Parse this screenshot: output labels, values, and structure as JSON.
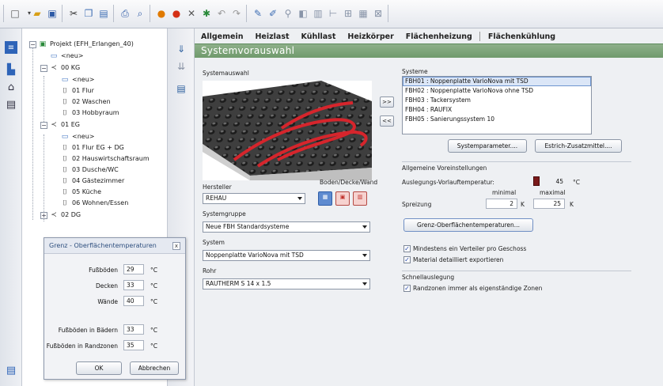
{
  "toolbar": {
    "icons": [
      "new-file-icon",
      "open-folder-icon",
      "save-icon",
      "cut-icon",
      "copy-icon",
      "paste-icon",
      "print-icon",
      "print-preview-icon",
      "info-icon",
      "warning-icon",
      "tools-icon",
      "settings-icon",
      "undo-icon",
      "redo-icon",
      "pencil-icon",
      "draw-icon",
      "plumbing-icon",
      "layer-icon",
      "radiator-icon",
      "pipe-icon",
      "grid-icon",
      "floor-icon",
      "delete-icon"
    ]
  },
  "tree": {
    "items": [
      {
        "label": "Projekt (EFH_Erlangen_40)",
        "level": 0
      },
      {
        "label": "<neu>",
        "level": 1
      },
      {
        "label": "00 KG",
        "level": 1
      },
      {
        "label": "<neu>",
        "level": 2
      },
      {
        "label": "01 Flur",
        "level": 2
      },
      {
        "label": "02 Waschen",
        "level": 2
      },
      {
        "label": "03 Hobbyraum",
        "level": 2
      },
      {
        "label": "01 EG",
        "level": 1
      },
      {
        "label": "<neu>",
        "level": 2
      },
      {
        "label": "01 Flur EG + DG",
        "level": 2
      },
      {
        "label": "02 Hauswirtschaftsraum",
        "level": 2
      },
      {
        "label": "03 Dusche/WC",
        "level": 2
      },
      {
        "label": "04 Gästezimmer",
        "level": 2
      },
      {
        "label": "05 Küche",
        "level": 2
      },
      {
        "label": "06 Wohnen/Essen",
        "level": 2
      },
      {
        "label": "02 DG",
        "level": 1
      }
    ]
  },
  "tabs": [
    "Allgemein",
    "Heizlast",
    "Kühllast",
    "Heizkörper",
    "Flächenheizung",
    "Flächenkühlung"
  ],
  "active_tab": "Flächenheizung",
  "section_title": "Systemvorauswahl",
  "systemauswahl": {
    "label": "Systemauswahl",
    "hersteller_label": "Hersteller",
    "hersteller_value": "REHAU",
    "boden_label": "Boden/Decke/Wand",
    "systemgruppe_label": "Systemgruppe",
    "systemgruppe_value": "Neue FBH Standardsysteme",
    "system_label": "System",
    "system_value": "Noppenplatte VarioNova mit TSD",
    "rohr_label": "Rohr",
    "rohr_value": "RAUTHERM S 14 x 1.5"
  },
  "transfer": {
    "add": ">>",
    "remove": "<<"
  },
  "systeme": {
    "label": "Systeme",
    "items": [
      "FBH01 : Noppenplatte VarioNova mit TSD",
      "FBH02 : Noppenplatte VarioNova ohne TSD",
      "FBH03 : Tackersystem",
      "FBH04 : RAUFIX",
      "FBH05 : Sanierungssystem 10"
    ],
    "selected_index": 0,
    "systemparameter_btn": "Systemparameter....",
    "estrich_btn": "Estrich-Zusatzmittel...."
  },
  "voreinstellungen": {
    "label": "Allgemeine Voreinstellungen",
    "vorlauf_label": "Auslegungs-Vorlauftemperatur:",
    "vorlauf_value": "45",
    "vorlauf_unit": "°C",
    "minimal_label": "minimal",
    "maximal_label": "maximal",
    "spreizung_label": "Spreizung",
    "spreizung_min": "2",
    "spreizung_max": "25",
    "unit_k": "K",
    "grenz_btn": "Grenz-Oberflächentemperaturen...",
    "chk1_label": "Mindestens ein Verteiler pro Geschoss",
    "chk1_checked": true,
    "chk2_label": "Material detailliert exportieren",
    "chk2_checked": true
  },
  "schnell": {
    "label": "Schnellauslegung",
    "chk_label": "Randzonen immer als eigenständige Zonen",
    "chk_checked": true
  },
  "dialog": {
    "title": "Grenz - Oberflächentemperaturen",
    "close": "x",
    "rows": [
      {
        "label": "Fußböden",
        "value": "29",
        "unit": "°C"
      },
      {
        "label": "Decken",
        "value": "33",
        "unit": "°C"
      },
      {
        "label": "Wände",
        "value": "40",
        "unit": "°C"
      },
      {
        "label": "Fußböden in Bädern",
        "value": "33",
        "unit": "°C"
      },
      {
        "label": "Fußböden in Randzonen",
        "value": "35",
        "unit": "°C"
      }
    ],
    "ok": "OK",
    "cancel": "Abbrechen"
  }
}
